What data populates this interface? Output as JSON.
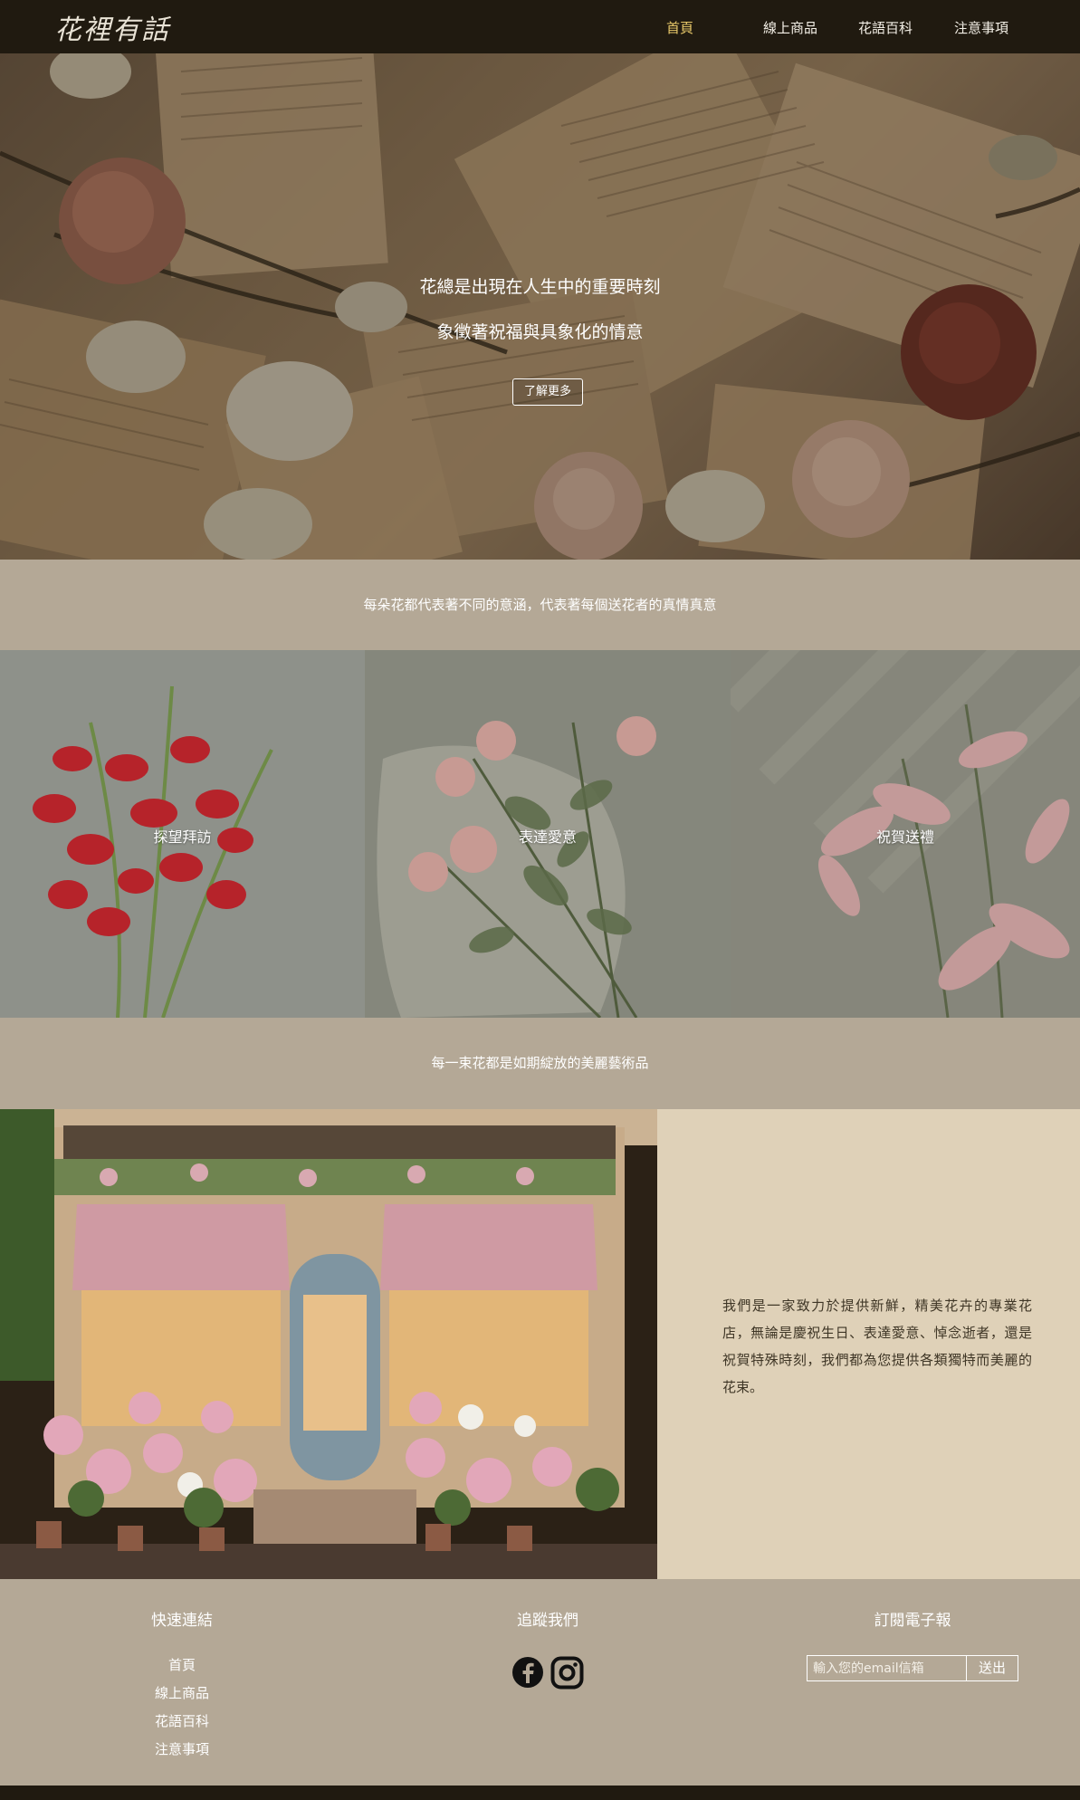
{
  "nav": {
    "logo": "花裡有話",
    "links": [
      "首頁",
      "線上商品",
      "花語百科",
      "注意事項"
    ],
    "active_index": 0
  },
  "hero": {
    "line1": "花總是出現在人生中的重要時刻",
    "line2": "象徵著祝福與具象化的情意",
    "button": "了解更多"
  },
  "band1": {
    "text": "每朵花都代表著不同的意涵，代表著每個送花者的真情真意"
  },
  "tiles": [
    {
      "label": "探望拜訪"
    },
    {
      "label": "表達愛意"
    },
    {
      "label": "祝賀送禮"
    }
  ],
  "band2": {
    "text": "每一束花都是如期綻放的美麗藝術品"
  },
  "about": {
    "text": "我們是一家致力於提供新鮮，精美花卉的專業花店，無論是慶祝生日、表達愛意、悼念逝者，還是祝賀特殊時刻，我們都為您提供各類獨特而美麗的花束。"
  },
  "footer": {
    "quick_links_title": "快速連結",
    "quick_links": [
      "首頁",
      "線上商品",
      "花語百科",
      "注意事項"
    ],
    "follow_title": "追蹤我們",
    "social_icons": [
      "facebook-icon",
      "instagram-icon"
    ],
    "newsletter_title": "訂閱電子報",
    "email_placeholder": "輸入您的email信箱",
    "send_label": "送出"
  },
  "colors": {
    "nav_bg": "#201a10",
    "band_bg": "#b4a896",
    "about_panel_bg": "#dfd1b8",
    "active_link": "#e9c96a"
  }
}
